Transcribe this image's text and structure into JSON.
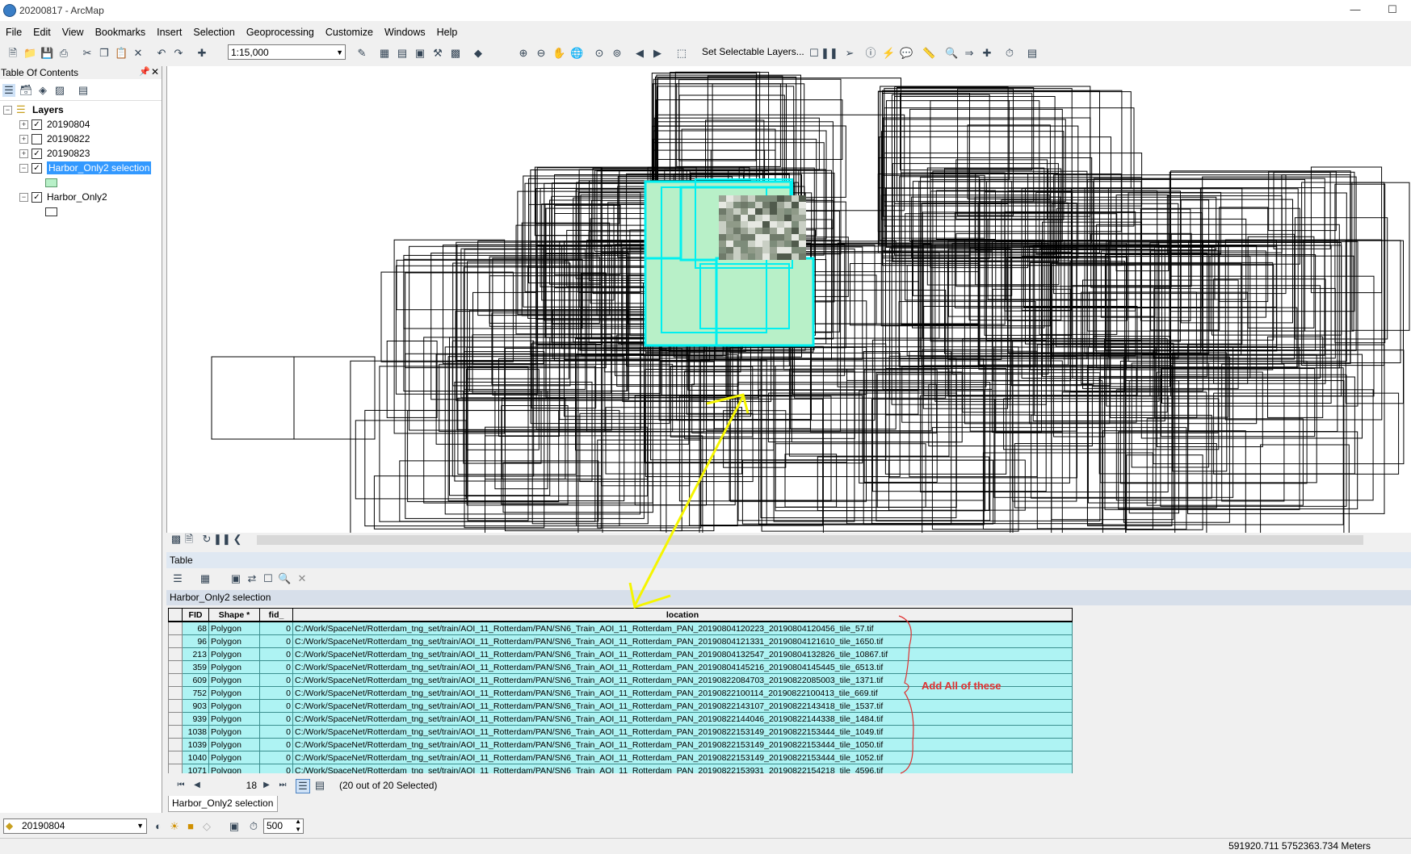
{
  "window": {
    "title": "20200817 - ArcMap",
    "minimize": "—",
    "maximize": "☐"
  },
  "menu": [
    "File",
    "Edit",
    "View",
    "Bookmarks",
    "Insert",
    "Selection",
    "Geoprocessing",
    "Customize",
    "Windows",
    "Help"
  ],
  "toolbar": {
    "scale": "1:15,000",
    "set_selectable_label": "Set Selectable Layers..."
  },
  "toc": {
    "title": "Table Of Contents",
    "root_label": "Layers",
    "layers": [
      {
        "label": "20190804",
        "checked": true,
        "expanded": false
      },
      {
        "label": "20190822",
        "checked": false,
        "expanded": false
      },
      {
        "label": "20190823",
        "checked": true,
        "expanded": false
      },
      {
        "label": "Harbor_Only2 selection",
        "checked": true,
        "expanded": true,
        "selected": true,
        "swatch": "#b8f0c8"
      },
      {
        "label": "Harbor_Only2",
        "checked": true,
        "expanded": true,
        "swatch": "#ffffff"
      }
    ]
  },
  "table": {
    "panel_title": "Table",
    "layer_name": "Harbor_Only2 selection",
    "columns": [
      "FID",
      "Shape *",
      "fid_",
      "location"
    ],
    "rows": [
      [
        "68",
        "Polygon",
        "0",
        "C:/Work/SpaceNet/Rotterdam_tng_set/train/AOI_11_Rotterdam/PAN/SN6_Train_AOI_11_Rotterdam_PAN_20190804120223_20190804120456_tile_57.tif"
      ],
      [
        "96",
        "Polygon",
        "0",
        "C:/Work/SpaceNet/Rotterdam_tng_set/train/AOI_11_Rotterdam/PAN/SN6_Train_AOI_11_Rotterdam_PAN_20190804121331_20190804121610_tile_1650.tif"
      ],
      [
        "213",
        "Polygon",
        "0",
        "C:/Work/SpaceNet/Rotterdam_tng_set/train/AOI_11_Rotterdam/PAN/SN6_Train_AOI_11_Rotterdam_PAN_20190804132547_20190804132826_tile_10867.tif"
      ],
      [
        "359",
        "Polygon",
        "0",
        "C:/Work/SpaceNet/Rotterdam_tng_set/train/AOI_11_Rotterdam/PAN/SN6_Train_AOI_11_Rotterdam_PAN_20190804145216_20190804145445_tile_6513.tif"
      ],
      [
        "609",
        "Polygon",
        "0",
        "C:/Work/SpaceNet/Rotterdam_tng_set/train/AOI_11_Rotterdam/PAN/SN6_Train_AOI_11_Rotterdam_PAN_20190822084703_20190822085003_tile_1371.tif"
      ],
      [
        "752",
        "Polygon",
        "0",
        "C:/Work/SpaceNet/Rotterdam_tng_set/train/AOI_11_Rotterdam/PAN/SN6_Train_AOI_11_Rotterdam_PAN_20190822100114_20190822100413_tile_669.tif"
      ],
      [
        "903",
        "Polygon",
        "0",
        "C:/Work/SpaceNet/Rotterdam_tng_set/train/AOI_11_Rotterdam/PAN/SN6_Train_AOI_11_Rotterdam_PAN_20190822143107_20190822143418_tile_1537.tif"
      ],
      [
        "939",
        "Polygon",
        "0",
        "C:/Work/SpaceNet/Rotterdam_tng_set/train/AOI_11_Rotterdam/PAN/SN6_Train_AOI_11_Rotterdam_PAN_20190822144046_20190822144338_tile_1484.tif"
      ],
      [
        "1038",
        "Polygon",
        "0",
        "C:/Work/SpaceNet/Rotterdam_tng_set/train/AOI_11_Rotterdam/PAN/SN6_Train_AOI_11_Rotterdam_PAN_20190822153149_20190822153444_tile_1049.tif"
      ],
      [
        "1039",
        "Polygon",
        "0",
        "C:/Work/SpaceNet/Rotterdam_tng_set/train/AOI_11_Rotterdam/PAN/SN6_Train_AOI_11_Rotterdam_PAN_20190822153149_20190822153444_tile_1050.tif"
      ],
      [
        "1040",
        "Polygon",
        "0",
        "C:/Work/SpaceNet/Rotterdam_tng_set/train/AOI_11_Rotterdam/PAN/SN6_Train_AOI_11_Rotterdam_PAN_20190822153149_20190822153444_tile_1052.tif"
      ],
      [
        "1071",
        "Polygon",
        "0",
        "C:/Work/SpaceNet/Rotterdam_tng_set/train/AOI_11_Rotterdam/PAN/SN6_Train_AOI_11_Rotterdam_PAN_20190822153931_20190822154218_tile_4596.tif"
      ]
    ],
    "record_number": "18",
    "selected_text": "(20 out of 20 Selected)",
    "tab_label": "Harbor_Only2 selection"
  },
  "annotation": {
    "text": "Add All of these",
    "color": "#e03030",
    "arrow_color": "#f5f500"
  },
  "bottom": {
    "layer_combo": "20190804",
    "tolerance": "500"
  },
  "status": {
    "coords": "591920.711  5752363.734 Meters"
  },
  "colors": {
    "selection_fill": "#b8f0c8",
    "selection_outline": "#00f0f0",
    "table_row": "#aef3f3",
    "toc_selected": "#3399ff"
  }
}
